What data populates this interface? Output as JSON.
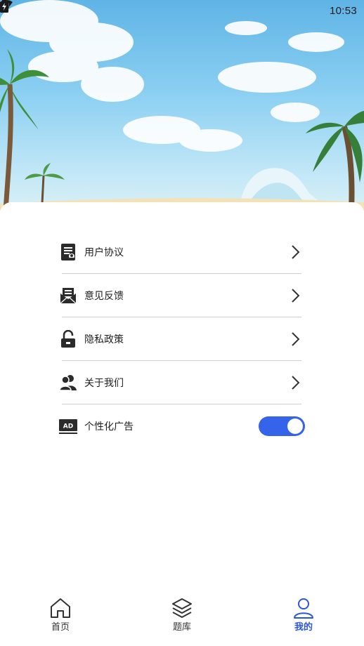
{
  "status_bar": {
    "time": "10:53"
  },
  "menu": {
    "items": [
      {
        "label": "用户协议",
        "icon": "document-icon"
      },
      {
        "label": "意见反馈",
        "icon": "mail-icon"
      },
      {
        "label": "隐私政策",
        "icon": "unlock-icon"
      },
      {
        "label": "关于我们",
        "icon": "users-icon"
      }
    ],
    "ads": {
      "label": "个性化广告",
      "icon": "ad-icon",
      "badge": "AD",
      "enabled": true
    }
  },
  "bottom_nav": {
    "items": [
      {
        "label": "首页",
        "icon": "home-icon",
        "active": false
      },
      {
        "label": "题库",
        "icon": "layers-icon",
        "active": false
      },
      {
        "label": "我的",
        "icon": "person-icon",
        "active": true
      }
    ]
  },
  "colors": {
    "accent": "#3563e9",
    "active_nav": "#2c56d6",
    "divider": "#cfcfcf"
  }
}
